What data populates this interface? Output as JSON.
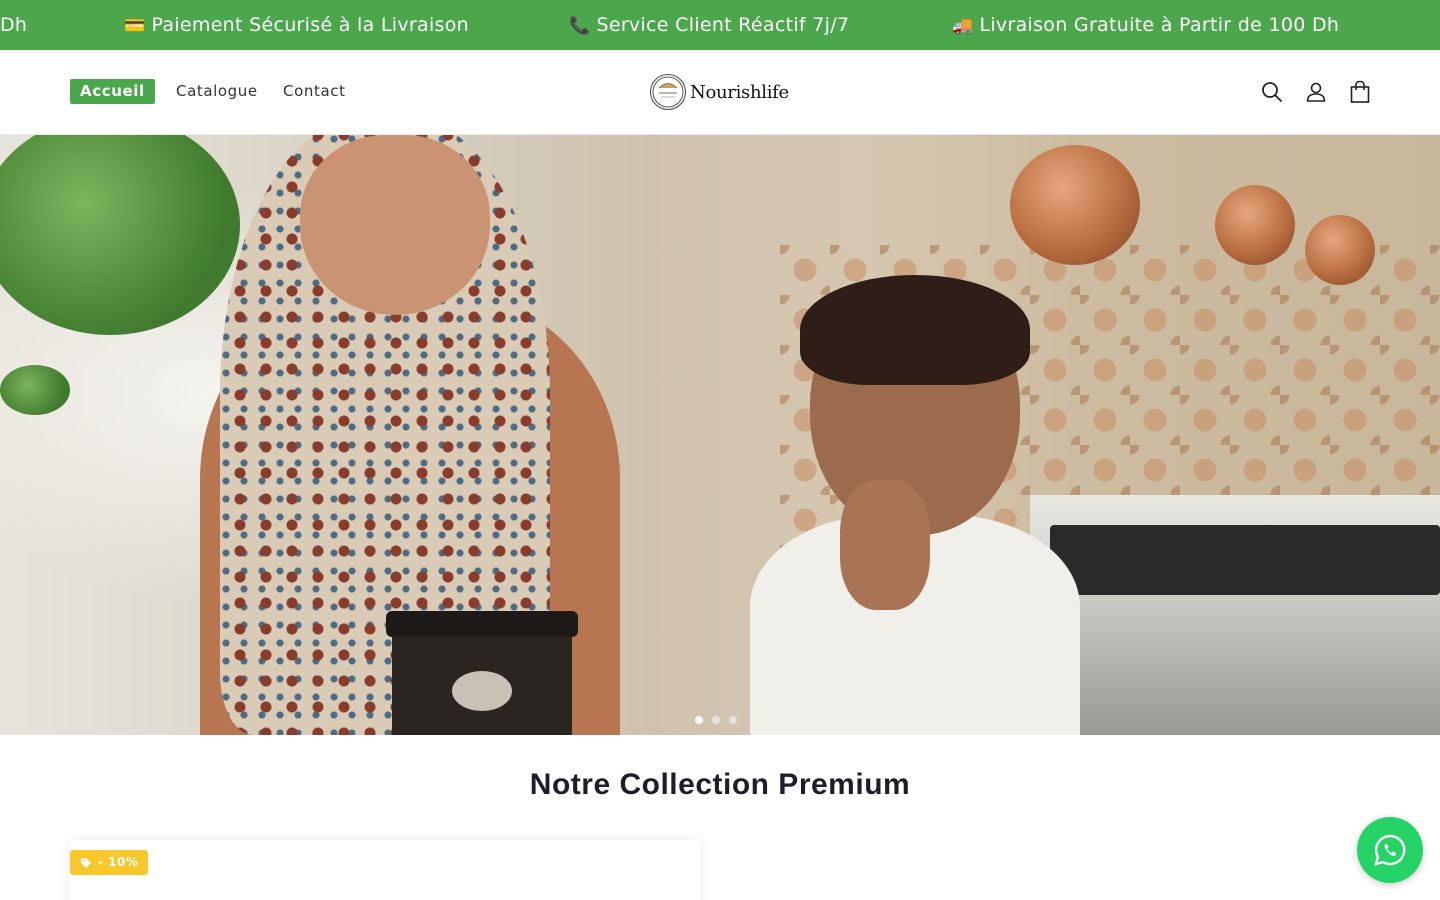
{
  "announcement": {
    "items": [
      {
        "emoji": "",
        "text": "Dh"
      },
      {
        "emoji": "💳",
        "text": "Paiement Sécurisé à la Livraison"
      },
      {
        "emoji": "📞",
        "text": "Service Client Réactif 7j/7"
      },
      {
        "emoji": "🚚",
        "text": "Livraison Gratuite  à Partir de 100 Dh"
      }
    ],
    "background": "#4ca64c"
  },
  "header": {
    "nav": [
      {
        "label": "Accueil",
        "active": true
      },
      {
        "label": "Catalogue",
        "active": false
      },
      {
        "label": "Contact",
        "active": false
      }
    ],
    "logo": {
      "mark_text": "Nourishlife",
      "text": "Nourishlife"
    },
    "icons": [
      "search-icon",
      "account-icon",
      "cart-icon"
    ]
  },
  "hero": {
    "slides_total": 3,
    "active_slide": 1
  },
  "collection": {
    "title": "Notre Collection Premium",
    "badge": "- 10%"
  },
  "accent_colors": {
    "green": "#4ca64c",
    "badge_yellow": "#f7c72b",
    "whatsapp": "#25d366"
  }
}
